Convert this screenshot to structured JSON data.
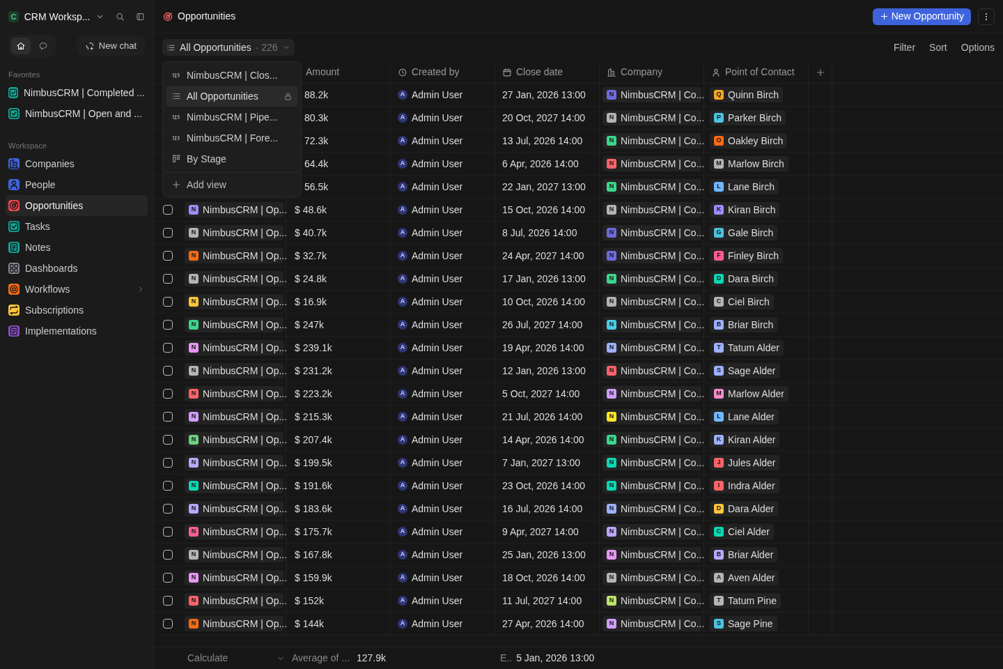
{
  "sidebar": {
    "workspace": {
      "letter": "C",
      "name": "CRM Worksp..."
    },
    "nav_tabs": [
      {
        "kind": "home",
        "selected": true
      },
      {
        "kind": "chat",
        "selected": false
      }
    ],
    "new_chat": "New chat",
    "favorites_label": "Favorites",
    "favorites": [
      {
        "label": "NimbusCRM | Completed ...",
        "color": "#12a594"
      },
      {
        "label": "NimbusCRM | Open and ...",
        "color": "#12a594"
      }
    ],
    "workspace_label": "Workspace",
    "items": [
      {
        "kind": "building",
        "label": "Companies",
        "color": "#3e63dd",
        "selected": false,
        "expandable": false
      },
      {
        "kind": "person",
        "label": "People",
        "color": "#3e63dd",
        "selected": false,
        "expandable": false
      },
      {
        "kind": "target",
        "label": "Opportunities",
        "color": "#e5484d",
        "selected": true,
        "expandable": false
      },
      {
        "kind": "check",
        "label": "Tasks",
        "color": "#12a594",
        "selected": false,
        "expandable": false
      },
      {
        "kind": "note",
        "label": "Notes",
        "color": "#12a594",
        "selected": false,
        "expandable": false
      },
      {
        "kind": "grid",
        "label": "Dashboards",
        "color": "#8b8d98",
        "selected": false,
        "expandable": false
      },
      {
        "kind": "cog",
        "label": "Workflows",
        "color": "#f76b15",
        "selected": false,
        "expandable": true
      },
      {
        "kind": "repeat",
        "label": "Subscriptions",
        "color": "#ffc53d",
        "selected": false,
        "expandable": false
      },
      {
        "kind": "doc",
        "label": "Implementations",
        "color": "#8e4ec6",
        "selected": false,
        "expandable": false
      }
    ]
  },
  "header": {
    "title": "Opportunities",
    "new_button": "New Opportunity"
  },
  "toolbar": {
    "view": "All Opportunities",
    "count": "· 226",
    "actions": [
      "Filter",
      "Sort",
      "Options"
    ]
  },
  "view_menu": {
    "items": [
      {
        "kind": "number",
        "label": "NimbusCRM | Clos...",
        "selected": false,
        "locked": false
      },
      {
        "kind": "list",
        "label": "All Opportunities",
        "selected": true,
        "locked": true
      },
      {
        "kind": "number",
        "label": "NimbusCRM | Pipe...",
        "selected": false,
        "locked": false
      },
      {
        "kind": "number",
        "label": "NimbusCRM | Fore...",
        "selected": false,
        "locked": false
      },
      {
        "kind": "kanban",
        "label": "By Stage",
        "selected": false,
        "locked": false
      }
    ],
    "add": "Add view"
  },
  "table": {
    "columns": [
      {
        "kind": "amount",
        "label": "Amount"
      },
      {
        "kind": "creator",
        "label": "Created by"
      },
      {
        "kind": "date",
        "label": "Close date"
      },
      {
        "kind": "company",
        "label": "Company"
      },
      {
        "kind": "person",
        "label": "Point of Contact"
      }
    ],
    "rows": [
      {
        "amount": "88.2k",
        "creator": {
          "letter": "A",
          "label": "Admin User"
        },
        "date": "27 Jan, 2026 13:00",
        "company": {
          "letter": "N",
          "label": "NimbusCRM | Co...",
          "color": "#6e6ade"
        },
        "contact": {
          "letter": "Q",
          "label": "Quinn Birch",
          "color": "#f5a623"
        }
      },
      {
        "amount": "80.3k",
        "creator": {
          "letter": "A",
          "label": "Admin User"
        },
        "date": "20 Oct, 2027 14:00",
        "company": {
          "letter": "N",
          "label": "NimbusCRM | Co...",
          "color": "#b4b4b4"
        },
        "contact": {
          "letter": "P",
          "label": "Parker Birch",
          "color": "#4cc3e0"
        }
      },
      {
        "amount": "72.3k",
        "creator": {
          "letter": "A",
          "label": "Admin User"
        },
        "date": "13 Jul, 2026 14:00",
        "company": {
          "letter": "N",
          "label": "NimbusCRM | Co...",
          "color": "#3dd68c"
        },
        "contact": {
          "letter": "O",
          "label": "Oakley Birch",
          "color": "#f76b15"
        }
      },
      {
        "amount": "64.4k",
        "creator": {
          "letter": "A",
          "label": "Admin User"
        },
        "date": "6 Apr, 2026 14:00",
        "company": {
          "letter": "N",
          "label": "NimbusCRM | Co...",
          "color": "#ff6369"
        },
        "contact": {
          "letter": "M",
          "label": "Marlow Birch",
          "color": "#b4b4b4"
        }
      },
      {
        "amount": "56.5k",
        "creator": {
          "letter": "A",
          "label": "Admin User"
        },
        "date": "22 Jan, 2027 13:00",
        "company": {
          "letter": "N",
          "label": "NimbusCRM | Co...",
          "color": "#3dd68c"
        },
        "contact": {
          "letter": "L",
          "label": "Lane Birch",
          "color": "#70b8ff"
        }
      },
      {
        "checked": false,
        "name": {
          "letter": "N",
          "label": "NimbusCRM | Op...",
          "color": "#9e8cfc"
        },
        "amount": "$ 48.6k",
        "creator": {
          "letter": "A",
          "label": "Admin User"
        },
        "date": "15 Oct, 2026 14:00",
        "company": {
          "letter": "N",
          "label": "NimbusCRM | Co...",
          "color": "#b4b4b4"
        },
        "contact": {
          "letter": "K",
          "label": "Kiran Birch",
          "color": "#9e8cfc"
        }
      },
      {
        "checked": false,
        "name": {
          "letter": "N",
          "label": "NimbusCRM | Op...",
          "color": "#b4b4b4"
        },
        "amount": "$ 40.7k",
        "creator": {
          "letter": "A",
          "label": "Admin User"
        },
        "date": "8 Jul, 2026 14:00",
        "company": {
          "letter": "N",
          "label": "NimbusCRM | Co...",
          "color": "#6e6ade"
        },
        "contact": {
          "letter": "G",
          "label": "Gale Birch",
          "color": "#4cc3e0"
        }
      },
      {
        "checked": false,
        "name": {
          "letter": "N",
          "label": "NimbusCRM | Op...",
          "color": "#f76b15"
        },
        "amount": "$ 32.7k",
        "creator": {
          "letter": "A",
          "label": "Admin User"
        },
        "date": "24 Apr, 2027 14:00",
        "company": {
          "letter": "N",
          "label": "NimbusCRM | Co...",
          "color": "#6e6ade"
        },
        "contact": {
          "letter": "F",
          "label": "Finley Birch",
          "color": "#ff5d8f"
        }
      },
      {
        "checked": false,
        "name": {
          "letter": "N",
          "label": "NimbusCRM | Op...",
          "color": "#b4b4b4"
        },
        "amount": "$ 24.8k",
        "creator": {
          "letter": "A",
          "label": "Admin User"
        },
        "date": "17 Jan, 2026 13:00",
        "company": {
          "letter": "N",
          "label": "NimbusCRM | Co...",
          "color": "#3dd68c"
        },
        "contact": {
          "letter": "D",
          "label": "Dara Birch",
          "color": "#0bd8b6"
        }
      },
      {
        "checked": false,
        "name": {
          "letter": "N",
          "label": "NimbusCRM | Op...",
          "color": "#ffc53d"
        },
        "amount": "$ 16.9k",
        "creator": {
          "letter": "A",
          "label": "Admin User"
        },
        "date": "10 Oct, 2026 14:00",
        "company": {
          "letter": "N",
          "label": "NimbusCRM | Co...",
          "color": "#b4b4b4"
        },
        "contact": {
          "letter": "C",
          "label": "Ciel Birch",
          "color": "#b4b4b4"
        }
      },
      {
        "checked": false,
        "name": {
          "letter": "N",
          "label": "NimbusCRM | Op...",
          "color": "#3dd68c"
        },
        "amount": "$ 247k",
        "creator": {
          "letter": "A",
          "label": "Admin User"
        },
        "date": "26 Jul, 2027 14:00",
        "company": {
          "letter": "N",
          "label": "NimbusCRM | Co...",
          "color": "#4ccce6"
        },
        "contact": {
          "letter": "B",
          "label": "Briar Birch",
          "color": "#9eb1ff"
        }
      },
      {
        "checked": false,
        "name": {
          "letter": "N",
          "label": "NimbusCRM | Op...",
          "color": "#e796f3"
        },
        "amount": "$ 239.1k",
        "creator": {
          "letter": "A",
          "label": "Admin User"
        },
        "date": "19 Apr, 2026 14:00",
        "company": {
          "letter": "N",
          "label": "NimbusCRM | Co...",
          "color": "#9eb1ff"
        },
        "contact": {
          "letter": "T",
          "label": "Tatum Alder",
          "color": "#9eb1ff"
        }
      },
      {
        "checked": false,
        "name": {
          "letter": "N",
          "label": "NimbusCRM | Op...",
          "color": "#b4b4b4"
        },
        "amount": "$ 231.2k",
        "creator": {
          "letter": "A",
          "label": "Admin User"
        },
        "date": "12 Jan, 2026 13:00",
        "company": {
          "letter": "N",
          "label": "NimbusCRM | Co...",
          "color": "#ff6369"
        },
        "contact": {
          "letter": "S",
          "label": "Sage Alder",
          "color": "#9eb1ff"
        }
      },
      {
        "checked": false,
        "name": {
          "letter": "N",
          "label": "NimbusCRM | Op...",
          "color": "#ff6369"
        },
        "amount": "$ 223.2k",
        "creator": {
          "letter": "A",
          "label": "Admin User"
        },
        "date": "5 Oct, 2027 14:00",
        "company": {
          "letter": "N",
          "label": "NimbusCRM | Co...",
          "color": "#d19dff"
        },
        "contact": {
          "letter": "M",
          "label": "Marlow Alder",
          "color": "#ff8dcc"
        }
      },
      {
        "checked": false,
        "name": {
          "letter": "N",
          "label": "NimbusCRM | Op...",
          "color": "#d19dff"
        },
        "amount": "$ 215.3k",
        "creator": {
          "letter": "A",
          "label": "Admin User"
        },
        "date": "21 Jul, 2026 14:00",
        "company": {
          "letter": "N",
          "label": "NimbusCRM | Co...",
          "color": "#ffe629"
        },
        "contact": {
          "letter": "L",
          "label": "Lane Alder",
          "color": "#70b8ff"
        }
      },
      {
        "checked": false,
        "name": {
          "letter": "N",
          "label": "NimbusCRM | Op...",
          "color": "#71d083"
        },
        "amount": "$ 207.4k",
        "creator": {
          "letter": "A",
          "label": "Admin User"
        },
        "date": "14 Apr, 2026 14:00",
        "company": {
          "letter": "N",
          "label": "NimbusCRM | Co...",
          "color": "#3dd68c"
        },
        "contact": {
          "letter": "K",
          "label": "Kiran Alder",
          "color": "#9eb1ff"
        }
      },
      {
        "checked": false,
        "name": {
          "letter": "N",
          "label": "NimbusCRM | Op...",
          "color": "#baa7ff"
        },
        "amount": "$ 199.5k",
        "creator": {
          "letter": "A",
          "label": "Admin User"
        },
        "date": "7 Jan, 2027 13:00",
        "company": {
          "letter": "N",
          "label": "NimbusCRM | Co...",
          "color": "#0bd8b6"
        },
        "contact": {
          "letter": "J",
          "label": "Jules Alder",
          "color": "#ff6369"
        }
      },
      {
        "checked": false,
        "name": {
          "letter": "N",
          "label": "NimbusCRM | Op...",
          "color": "#0bd8b6"
        },
        "amount": "$ 191.6k",
        "creator": {
          "letter": "A",
          "label": "Admin User"
        },
        "date": "23 Oct, 2026 14:00",
        "company": {
          "letter": "N",
          "label": "NimbusCRM | Co...",
          "color": "#0bd8b6"
        },
        "contact": {
          "letter": "I",
          "label": "Indra Alder",
          "color": "#ff6369"
        }
      },
      {
        "checked": false,
        "name": {
          "letter": "N",
          "label": "NimbusCRM | Op...",
          "color": "#baa7ff"
        },
        "amount": "$ 183.6k",
        "creator": {
          "letter": "A",
          "label": "Admin User"
        },
        "date": "16 Jul, 2026 14:00",
        "company": {
          "letter": "N",
          "label": "NimbusCRM | Co...",
          "color": "#9eb1ff"
        },
        "contact": {
          "letter": "D",
          "label": "Dara Alder",
          "color": "#ffc53d"
        }
      },
      {
        "checked": false,
        "name": {
          "letter": "N",
          "label": "NimbusCRM | Op...",
          "color": "#ff5d8f"
        },
        "amount": "$ 175.7k",
        "creator": {
          "letter": "A",
          "label": "Admin User"
        },
        "date": "9 Apr, 2027 14:00",
        "company": {
          "letter": "N",
          "label": "NimbusCRM | Co...",
          "color": "#baa7ff"
        },
        "contact": {
          "letter": "C",
          "label": "Ciel Alder",
          "color": "#0bd8b6"
        }
      },
      {
        "checked": false,
        "name": {
          "letter": "N",
          "label": "NimbusCRM | Op...",
          "color": "#b4b4b4"
        },
        "amount": "$ 167.8k",
        "creator": {
          "letter": "A",
          "label": "Admin User"
        },
        "date": "25 Jan, 2026 13:00",
        "company": {
          "letter": "N",
          "label": "NimbusCRM | Co...",
          "color": "#e796f3"
        },
        "contact": {
          "letter": "B",
          "label": "Briar Alder",
          "color": "#baa7ff"
        }
      },
      {
        "checked": false,
        "name": {
          "letter": "N",
          "label": "NimbusCRM | Op...",
          "color": "#e796f3"
        },
        "amount": "$ 159.9k",
        "creator": {
          "letter": "A",
          "label": "Admin User"
        },
        "date": "18 Oct, 2026 14:00",
        "company": {
          "letter": "N",
          "label": "NimbusCRM | Co...",
          "color": "#b4b4b4"
        },
        "contact": {
          "letter": "A",
          "label": "Aven Alder",
          "color": "#b4b4b4"
        }
      },
      {
        "checked": false,
        "name": {
          "letter": "N",
          "label": "NimbusCRM | Op...",
          "color": "#ff6369"
        },
        "amount": "$ 152k",
        "creator": {
          "letter": "A",
          "label": "Admin User"
        },
        "date": "11 Jul, 2027 14:00",
        "company": {
          "letter": "N",
          "label": "NimbusCRM | Co...",
          "color": "#bde56c"
        },
        "contact": {
          "letter": "T",
          "label": "Tatum Pine",
          "color": "#b4b4b4"
        }
      },
      {
        "checked": false,
        "name": {
          "letter": "N",
          "label": "NimbusCRM | Op...",
          "color": "#f76b15"
        },
        "amount": "$ 144k",
        "creator": {
          "letter": "A",
          "label": "Admin User"
        },
        "date": "27 Apr, 2026 14:00",
        "company": {
          "letter": "N",
          "label": "NimbusCRM | Co...",
          "color": "#d19dff"
        },
        "contact": {
          "letter": "S",
          "label": "Sage Pine",
          "color": "#4cc3e0"
        }
      }
    ]
  },
  "footer": {
    "calculate": "Calculate",
    "aggregate_label": "Average of ...",
    "aggregate_value": "127.9k",
    "date_label": "E..",
    "date_value": "5 Jan, 2026 13:00"
  }
}
